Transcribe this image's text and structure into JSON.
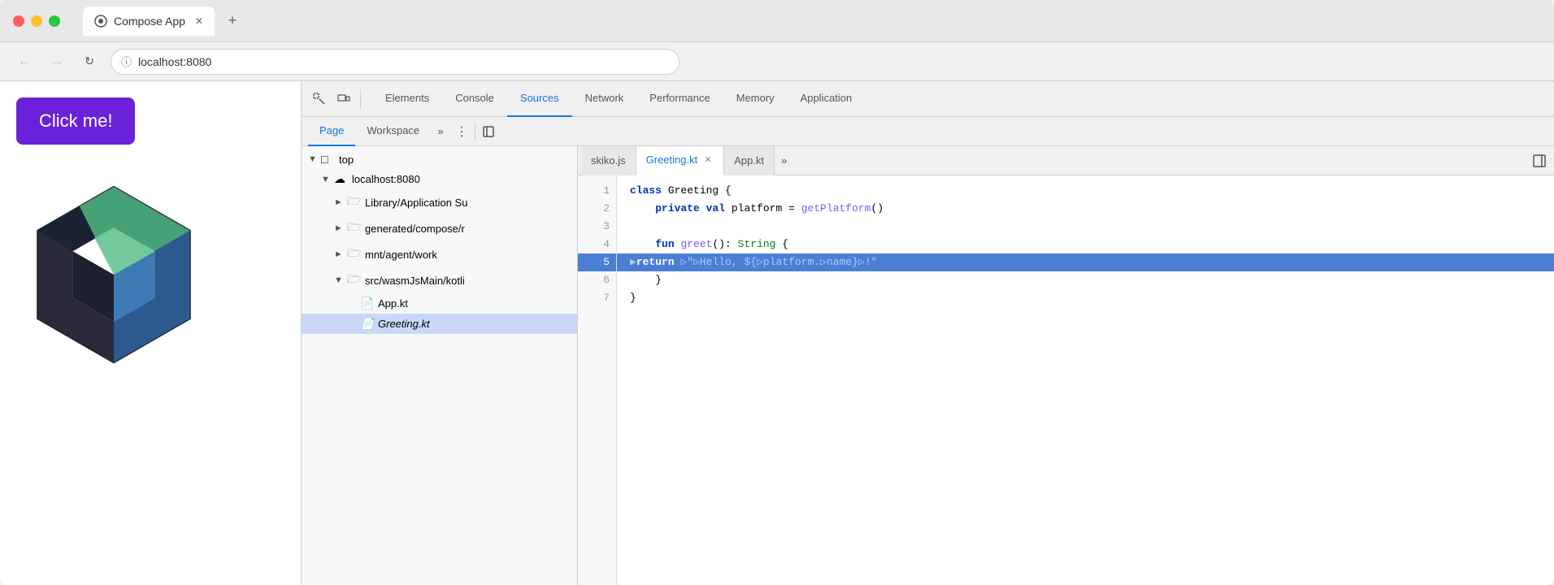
{
  "browser": {
    "tab_title": "Compose App",
    "url": "localhost:8080",
    "new_tab_label": "+"
  },
  "page": {
    "click_button_label": "Click me!"
  },
  "devtools": {
    "tabs": [
      "Elements",
      "Console",
      "Sources",
      "Network",
      "Performance",
      "Memory",
      "Application"
    ],
    "active_tab": "Sources",
    "subtabs": [
      "Page",
      "Workspace",
      ">>"
    ],
    "active_subtab": "Page",
    "code_tabs": [
      "skiko.js",
      "Greeting.kt",
      "App.kt",
      ">>"
    ],
    "active_code_tab": "Greeting.kt"
  },
  "filetree": {
    "items": [
      {
        "label": "top",
        "level": 1,
        "type": "folder-open",
        "expanded": true
      },
      {
        "label": "localhost:8080",
        "level": 2,
        "type": "cloud",
        "expanded": true
      },
      {
        "label": "Library/Application Su",
        "level": 3,
        "type": "folder-closed",
        "expanded": false
      },
      {
        "label": "generated/compose/r",
        "level": 3,
        "type": "folder-closed",
        "expanded": false
      },
      {
        "label": "mnt/agent/work",
        "level": 3,
        "type": "folder-closed",
        "expanded": false
      },
      {
        "label": "src/wasmJsMain/kotli",
        "level": 3,
        "type": "folder-open",
        "expanded": true
      },
      {
        "label": "App.kt",
        "level": 4,
        "type": "file"
      },
      {
        "label": "Greeting.kt",
        "level": 4,
        "type": "file",
        "selected": true
      }
    ]
  },
  "code": {
    "lines": [
      {
        "num": 1,
        "content": "class Greeting {",
        "type": "normal"
      },
      {
        "num": 2,
        "content": "    private val platform = getPlatform()",
        "type": "normal"
      },
      {
        "num": 3,
        "content": "",
        "type": "normal"
      },
      {
        "num": 4,
        "content": "    fun greet(): String {",
        "type": "normal"
      },
      {
        "num": 5,
        "content": "        ▶return \"Hello, ${platform.name}!\"",
        "type": "active"
      },
      {
        "num": 6,
        "content": "    }",
        "type": "normal"
      },
      {
        "num": 7,
        "content": "}",
        "type": "normal"
      }
    ]
  }
}
